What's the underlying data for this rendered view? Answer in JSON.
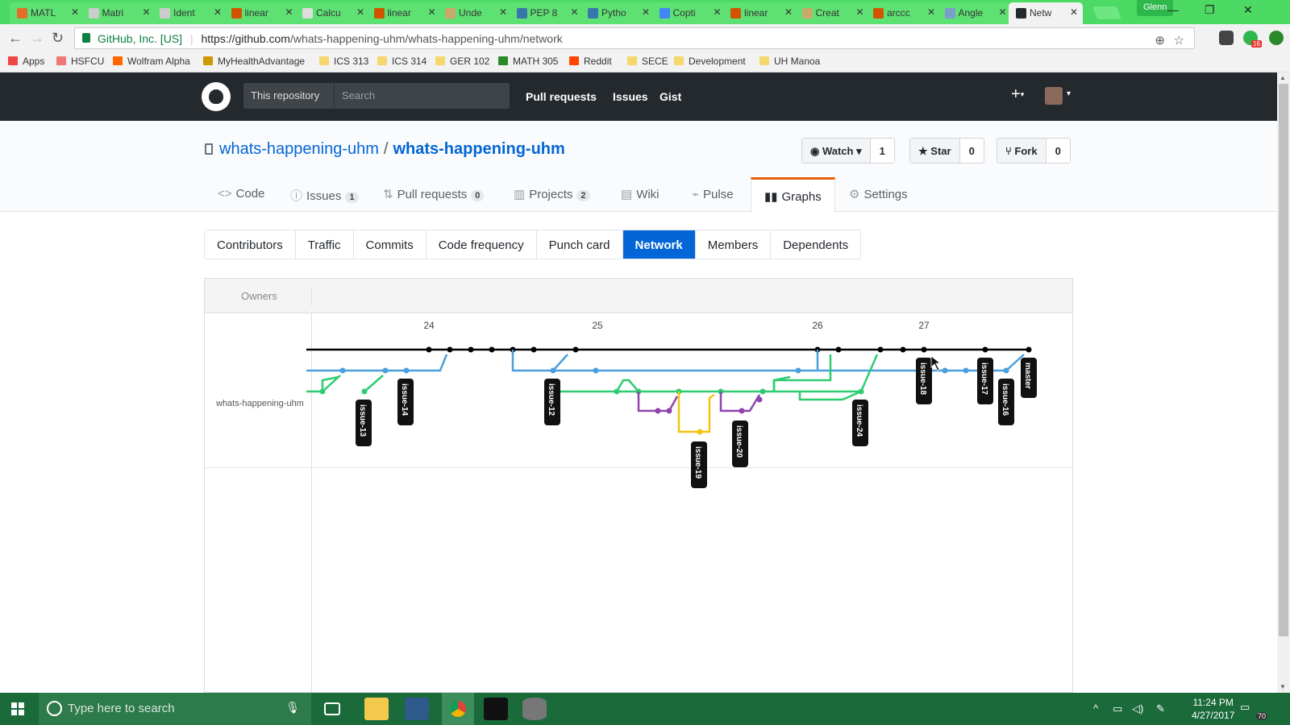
{
  "browser": {
    "tabs": [
      {
        "label": "MATL",
        "icon": "matlab-icon"
      },
      {
        "label": "Matri",
        "icon": "wikipedia-icon"
      },
      {
        "label": "Ident",
        "icon": "wikipedia-icon"
      },
      {
        "label": "linear",
        "icon": "wolfram-icon"
      },
      {
        "label": "Calcu",
        "icon": "page-icon"
      },
      {
        "label": "linear",
        "icon": "wolfram-icon"
      },
      {
        "label": "Unde",
        "icon": "book-icon"
      },
      {
        "label": "PEP 8",
        "icon": "python-icon"
      },
      {
        "label": "Pytho",
        "icon": "python-icon"
      },
      {
        "label": "Copti",
        "icon": "google-icon"
      },
      {
        "label": "linear",
        "icon": "wolfram-icon"
      },
      {
        "label": "Creat",
        "icon": "book-icon"
      },
      {
        "label": "arccc",
        "icon": "wolfram-icon"
      },
      {
        "label": "Angle",
        "icon": "chart-icon"
      },
      {
        "label": "Netw",
        "icon": "github-icon",
        "active": true
      }
    ],
    "profile_name": "Glenn",
    "site_identity": "GitHub, Inc. [US]",
    "url_prefix": "https://github.com",
    "url_path": "/whats-happening-uhm/whats-happening-uhm/network",
    "extension_badge": "16"
  },
  "bookmarks": [
    {
      "label": "Apps",
      "color": "#e44"
    },
    {
      "label": "HSFCU",
      "color": "#e77"
    },
    {
      "label": "Wolfram Alpha",
      "color": "#f60"
    },
    {
      "label": "MyHealthAdvantage",
      "color": "#c90"
    },
    {
      "label": "ICS 313",
      "color": "#f5d76e"
    },
    {
      "label": "ICS 314",
      "color": "#f5d76e"
    },
    {
      "label": "GER 102",
      "color": "#f5d76e"
    },
    {
      "label": "MATH 305",
      "color": "#2a8a2a"
    },
    {
      "label": "Reddit",
      "color": "#ff4500"
    },
    {
      "label": "SECE",
      "color": "#f5d76e"
    },
    {
      "label": "Development",
      "color": "#f5d76e"
    },
    {
      "label": "UH Manoa",
      "color": "#f5d76e"
    }
  ],
  "github": {
    "scope_label": "This repository",
    "search_placeholder": "Search",
    "nav": [
      "Pull requests",
      "Issues",
      "Gist"
    ],
    "plus_label": "+"
  },
  "repo": {
    "owner": "whats-happening-uhm",
    "separator": "/",
    "name": "whats-happening-uhm",
    "watch_label": "Watch",
    "watch_count": "1",
    "star_label": "Star",
    "star_count": "0",
    "fork_label": "Fork",
    "fork_count": "0",
    "tabs": [
      {
        "label": "Code",
        "count": null
      },
      {
        "label": "Issues",
        "count": "1"
      },
      {
        "label": "Pull requests",
        "count": "0"
      },
      {
        "label": "Projects",
        "count": "2"
      },
      {
        "label": "Wiki",
        "count": null
      },
      {
        "label": "Pulse",
        "count": null
      },
      {
        "label": "Graphs",
        "count": null,
        "selected": true
      },
      {
        "label": "Settings",
        "count": null
      }
    ]
  },
  "graphs_subnav": [
    "Contributors",
    "Traffic",
    "Commits",
    "Code frequency",
    "Punch card",
    "Network",
    "Members",
    "Dependents"
  ],
  "graphs_subnav_active": "Network",
  "network": {
    "owners_label": "Owners",
    "owner_name": "whats-happening-uhm",
    "date_ticks": [
      "24",
      "25",
      "26",
      "27"
    ],
    "branch_labels": [
      "issue-13",
      "issue-14",
      "issue-12",
      "issue-19",
      "issue-20",
      "issue-24",
      "issue-18",
      "issue-17",
      "issue-16",
      "master"
    ],
    "branch_colors": {
      "master": "#000000",
      "blue": "#4a9fdc",
      "green": "#2ecc71",
      "purple": "#8e44ad",
      "yellow": "#f1c40f"
    }
  },
  "taskbar": {
    "search_placeholder": "Type here to search",
    "time": "11:24 PM",
    "date": "4/27/2017",
    "notification_count": "70"
  }
}
